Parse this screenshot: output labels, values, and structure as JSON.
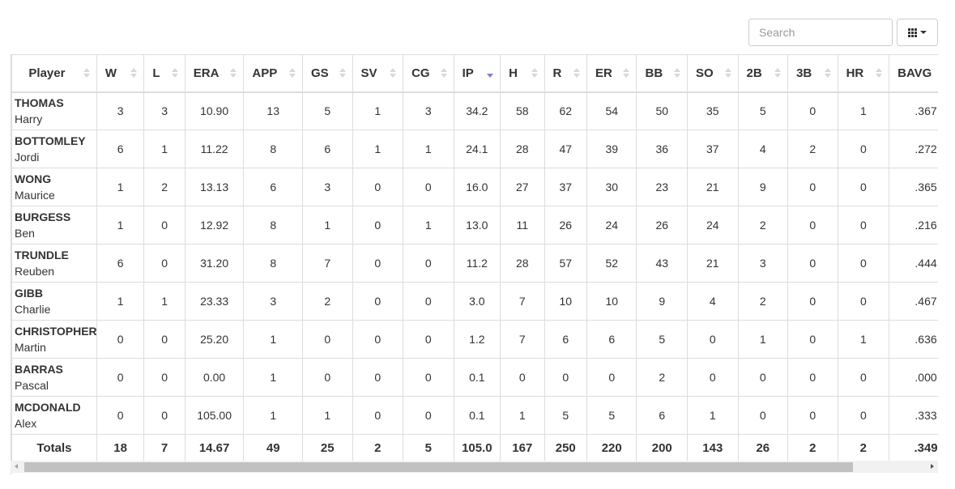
{
  "toolbar": {
    "search_placeholder": "Search",
    "search_value": "",
    "columns_button_icon": "grid-icon",
    "columns_button_caret": "caret-down-icon"
  },
  "table": {
    "sorted_column": "IP",
    "sort_direction": "desc",
    "columns": [
      "Player",
      "W",
      "L",
      "ERA",
      "APP",
      "GS",
      "SV",
      "CG",
      "IP",
      "H",
      "R",
      "ER",
      "BB",
      "SO",
      "2B",
      "3B",
      "HR",
      "BAVG"
    ],
    "rows": [
      {
        "last": "THOMAS",
        "first": "Harry",
        "stats": [
          "3",
          "3",
          "10.90",
          "13",
          "5",
          "1",
          "3",
          "34.2",
          "58",
          "62",
          "54",
          "50",
          "35",
          "5",
          "0",
          "1",
          ".367"
        ]
      },
      {
        "last": "BOTTOMLEY",
        "first": "Jordi",
        "stats": [
          "6",
          "1",
          "11.22",
          "8",
          "6",
          "1",
          "1",
          "24.1",
          "28",
          "47",
          "39",
          "36",
          "37",
          "4",
          "2",
          "0",
          ".272"
        ]
      },
      {
        "last": "WONG",
        "first": "Maurice",
        "stats": [
          "1",
          "2",
          "13.13",
          "6",
          "3",
          "0",
          "0",
          "16.0",
          "27",
          "37",
          "30",
          "23",
          "21",
          "9",
          "0",
          "0",
          ".365"
        ]
      },
      {
        "last": "BURGESS",
        "first": "Ben",
        "stats": [
          "1",
          "0",
          "12.92",
          "8",
          "1",
          "0",
          "1",
          "13.0",
          "11",
          "26",
          "24",
          "26",
          "24",
          "2",
          "0",
          "0",
          ".216"
        ]
      },
      {
        "last": "TRUNDLE",
        "first": "Reuben",
        "stats": [
          "6",
          "0",
          "31.20",
          "8",
          "7",
          "0",
          "0",
          "11.2",
          "28",
          "57",
          "52",
          "43",
          "21",
          "3",
          "0",
          "0",
          ".444"
        ]
      },
      {
        "last": "GIBB",
        "first": "Charlie",
        "stats": [
          "1",
          "1",
          "23.33",
          "3",
          "2",
          "0",
          "0",
          "3.0",
          "7",
          "10",
          "10",
          "9",
          "4",
          "2",
          "0",
          "0",
          ".467"
        ]
      },
      {
        "last": "CHRISTOPHER",
        "first": "Martin",
        "stats": [
          "0",
          "0",
          "25.20",
          "1",
          "0",
          "0",
          "0",
          "1.2",
          "7",
          "6",
          "6",
          "5",
          "0",
          "1",
          "0",
          "1",
          ".636"
        ]
      },
      {
        "last": "BARRAS",
        "first": "Pascal",
        "stats": [
          "0",
          "0",
          "0.00",
          "1",
          "0",
          "0",
          "0",
          "0.1",
          "0",
          "0",
          "0",
          "2",
          "0",
          "0",
          "0",
          "0",
          ".000"
        ]
      },
      {
        "last": "MCDONALD",
        "first": "Alex",
        "stats": [
          "0",
          "0",
          "105.00",
          "1",
          "1",
          "0",
          "0",
          "0.1",
          "1",
          "5",
          "5",
          "6",
          "1",
          "0",
          "0",
          "0",
          ".333"
        ]
      }
    ],
    "totals": {
      "label": "Totals",
      "stats": [
        "18",
        "7",
        "14.67",
        "49",
        "25",
        "2",
        "5",
        "105.0",
        "167",
        "250",
        "220",
        "200",
        "143",
        "26",
        "2",
        "2",
        ".349"
      ]
    }
  }
}
